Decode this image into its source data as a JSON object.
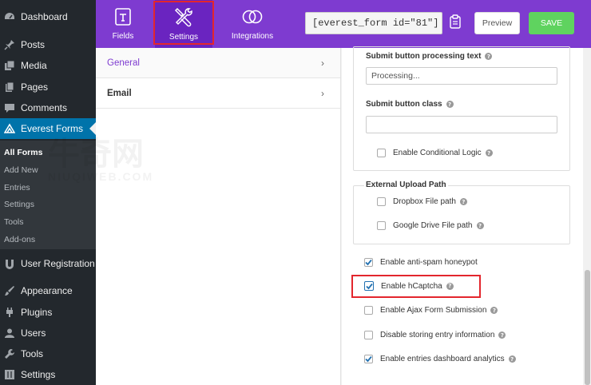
{
  "wp_menu": {
    "dashboard": "Dashboard",
    "posts": "Posts",
    "media": "Media",
    "pages": "Pages",
    "comments": "Comments",
    "everest_forms": "Everest Forms",
    "user_registration": "User Registration",
    "appearance": "Appearance",
    "plugins": "Plugins",
    "users": "Users",
    "tools": "Tools",
    "settings": "Settings"
  },
  "wp_submenu": {
    "all_forms": "All Forms",
    "add_new": "Add New",
    "entries": "Entries",
    "settings": "Settings",
    "tools": "Tools",
    "addons": "Add-ons"
  },
  "header": {
    "tabs": {
      "fields": "Fields",
      "settings": "Settings",
      "integrations": "Integrations"
    },
    "shortcode": "[everest_form id=\"81\"]",
    "preview": "Preview",
    "save": "SAVE"
  },
  "settings_nav": {
    "general": "General",
    "email": "Email"
  },
  "panel": {
    "submit_processing_label": "Submit button processing text",
    "submit_processing_value": "Processing...",
    "submit_class_label": "Submit button class",
    "submit_class_value": "",
    "enable_conditional_logic": "Enable Conditional Logic",
    "external_upload_title": "External Upload Path",
    "dropbox_path": "Dropbox File path",
    "google_drive_path": "Google Drive File path",
    "anti_spam": "Enable anti-spam honeypot",
    "hcaptcha": "Enable hCaptcha",
    "ajax_submission": "Enable Ajax Form Submission",
    "disable_storing": "Disable storing entry information",
    "entries_analytics": "Enable entries dashboard analytics"
  },
  "checkbox_states": {
    "enable_conditional_logic": false,
    "dropbox_path": false,
    "google_drive_path": false,
    "anti_spam": true,
    "hcaptcha": true,
    "ajax_submission": false,
    "disable_storing": false,
    "entries_analytics": true
  },
  "colors": {
    "builder_purple": "#7e3bd0",
    "wp_sidebar": "#23282d",
    "wp_active_blue": "#0073aa",
    "save_green": "#5fd35f",
    "highlight_red": "#e3262d"
  },
  "icons": {
    "fields": "fields-icon",
    "settings": "tools-icon",
    "integrations": "integrations-icon",
    "copy": "clipboard-icon",
    "chevron": "chevron-right-icon",
    "help": "help-icon"
  },
  "watermark": {
    "cn_text": "牛奇网",
    "domain_text": "NIUQIWEB.COM"
  }
}
